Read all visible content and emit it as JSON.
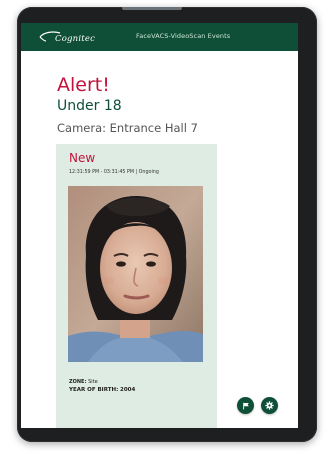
{
  "header": {
    "logo_text": "Cognitec",
    "app_title": "FaceVACS-VideoScan Events"
  },
  "alert": {
    "title": "Alert!",
    "type": "Under 18",
    "camera": "Camera: Entrance Hall 7"
  },
  "event": {
    "status": "New",
    "time_range": "12:31:59 PM - 03:31:45 PM | Ongoing",
    "zone_label": "ZONE:",
    "zone_value": "Site",
    "yob_label": "YEAR OF BIRTH:",
    "yob_value": "2004"
  },
  "actions": {
    "flag_icon": "flag-icon",
    "settings_icon": "settings-icon"
  },
  "colors": {
    "header_bg": "#0f4f38",
    "alert_red": "#c3133c",
    "card_bg": "#dfece3"
  }
}
